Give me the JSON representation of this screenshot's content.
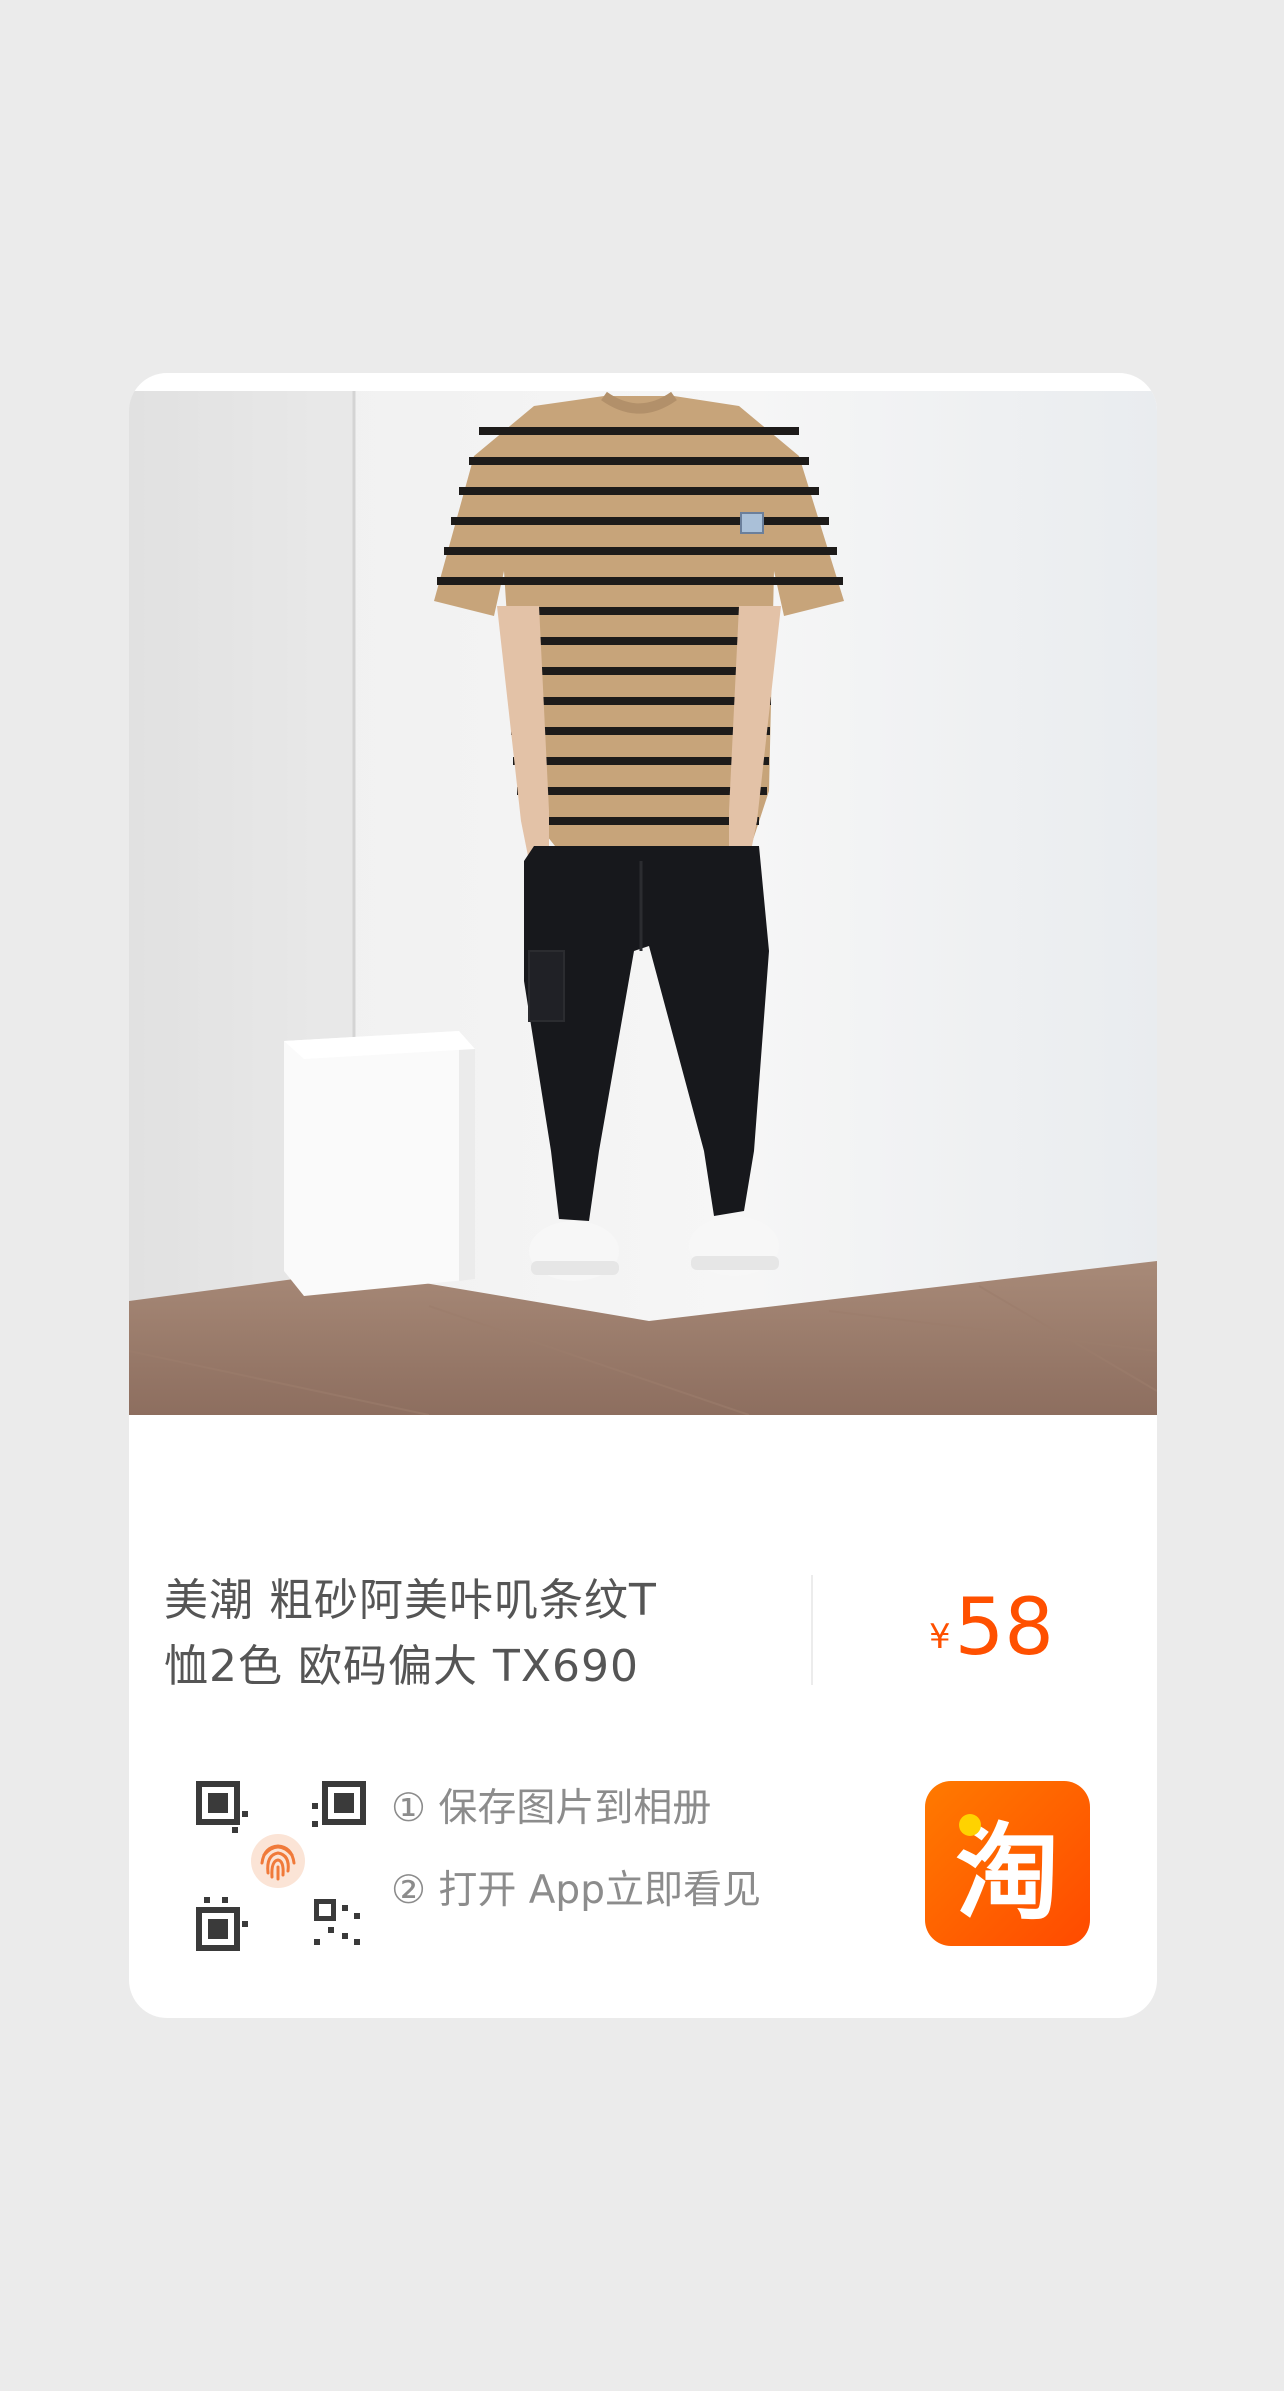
{
  "product": {
    "title_line1": "美潮 粗砂阿美咔叽条纹T",
    "title_line2": "恤2色 欧码偏大 TX690",
    "price_symbol": "¥",
    "price_value": "58"
  },
  "share": {
    "step1": "① 保存图片到相册",
    "step2": "② 打开 App立即看见"
  },
  "icons": {
    "qr": "qr-code-icon",
    "fingerprint": "fingerprint-icon",
    "app": "taobao-app-icon"
  },
  "app_icon_glyph": "淘",
  "colors": {
    "background": "#ebebeb",
    "price": "#ff5000",
    "app_icon": "#ff5a00"
  }
}
